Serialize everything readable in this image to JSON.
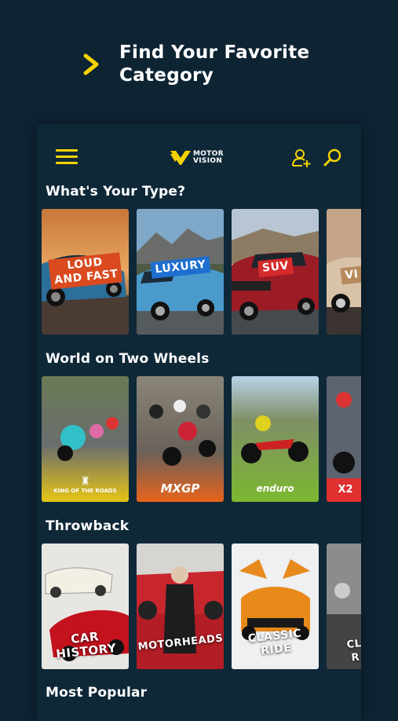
{
  "promo": {
    "title_line1": "Find Your Favorite",
    "title_line2": "Category"
  },
  "appbar": {
    "logo_line1": "MOTOR",
    "logo_line2": "VISION"
  },
  "sections": [
    {
      "title": "What's Your Type?",
      "cards": [
        {
          "label_line1": "LOUD",
          "label_line2": "AND FAST"
        },
        {
          "label_line1": "LUXURY"
        },
        {
          "label_line1": "SUV"
        },
        {
          "label_line1": "VI"
        }
      ]
    },
    {
      "title": "World on Two Wheels",
      "cards": [
        {
          "brand_line1": "KING",
          "brand_line2": "ROADS"
        },
        {
          "brand_line1": "MXGP"
        },
        {
          "brand_line1": "enduro"
        },
        {
          "brand_line1": "X2"
        }
      ]
    },
    {
      "title": "Throwback",
      "cards": [
        {
          "label_line1": "CAR",
          "label_line2": "HISTORY"
        },
        {
          "label_line1": "MOTORHEADS"
        },
        {
          "label_line1": "CLASSIC",
          "label_line2": "RIDE"
        },
        {
          "label_line1": "CL",
          "label_line2": "R"
        }
      ]
    },
    {
      "title": "Most Popular"
    }
  ]
}
